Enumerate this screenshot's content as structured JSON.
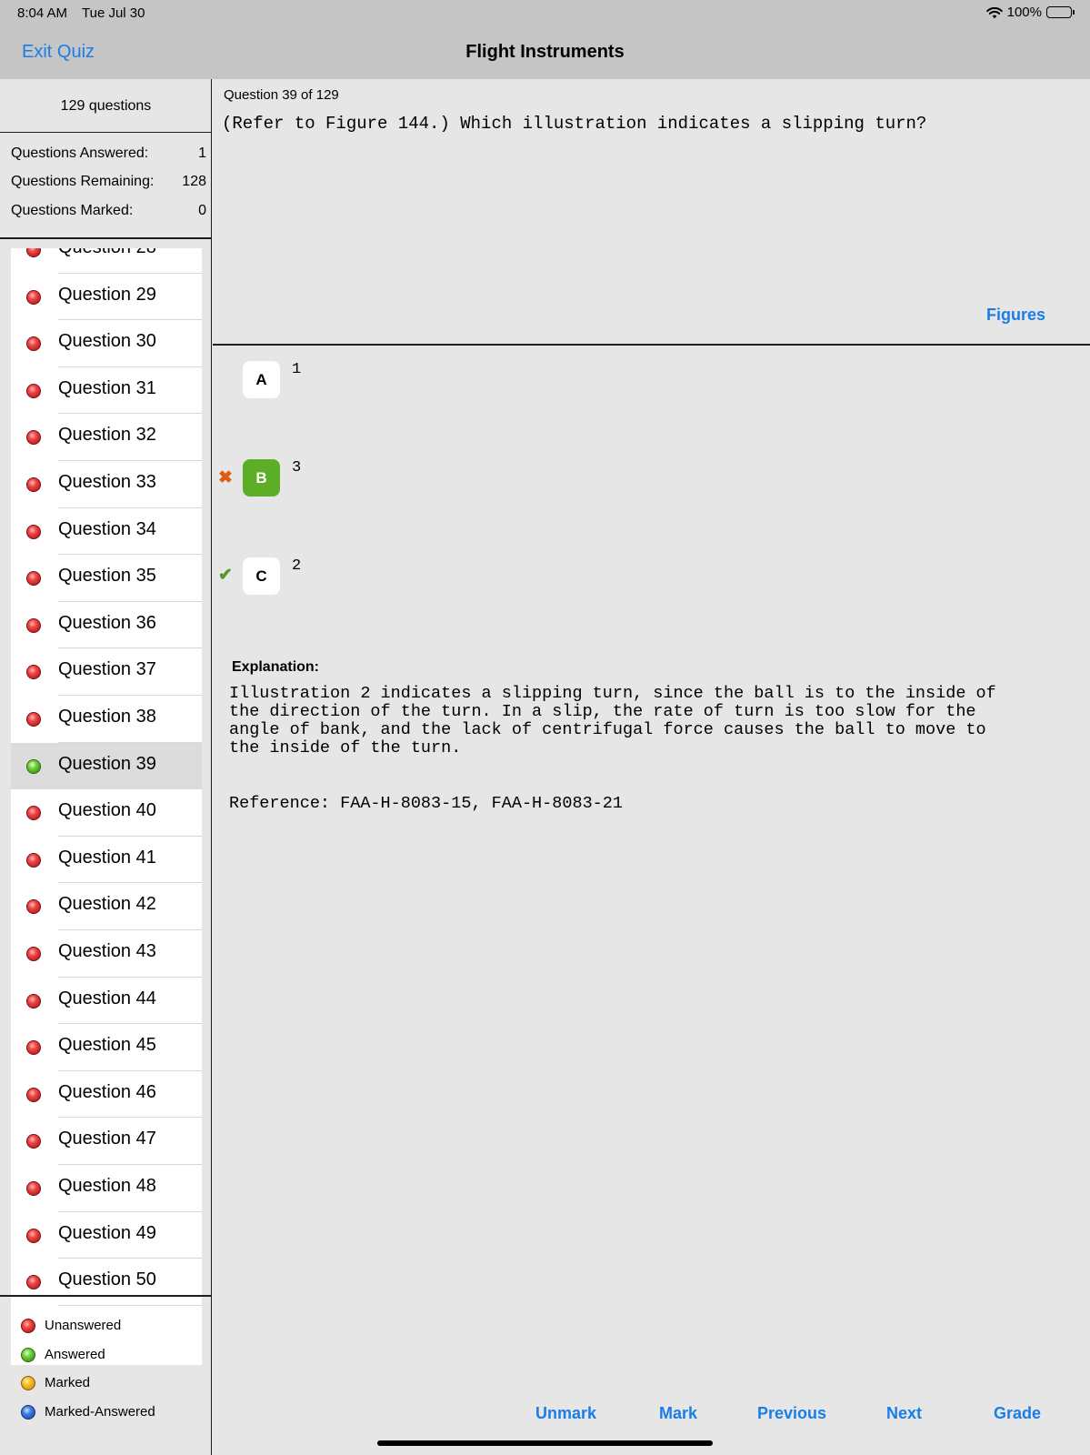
{
  "status_bar": {
    "time": "8:04 AM",
    "date": "Tue Jul 30",
    "battery": "100%"
  },
  "nav": {
    "exit_label": "Exit Quiz",
    "title": "Flight Instruments"
  },
  "sidebar": {
    "count_label": "129 questions",
    "stats": [
      {
        "label": "Questions Answered:",
        "value": "1"
      },
      {
        "label": "Questions Remaining:",
        "value": "128"
      },
      {
        "label": "Questions Marked:",
        "value": "0"
      }
    ],
    "questions": [
      {
        "label": "Question 28",
        "status": "unanswered"
      },
      {
        "label": "Question 29",
        "status": "unanswered"
      },
      {
        "label": "Question 30",
        "status": "unanswered"
      },
      {
        "label": "Question 31",
        "status": "unanswered"
      },
      {
        "label": "Question 32",
        "status": "unanswered"
      },
      {
        "label": "Question 33",
        "status": "unanswered"
      },
      {
        "label": "Question 34",
        "status": "unanswered"
      },
      {
        "label": "Question 35",
        "status": "unanswered"
      },
      {
        "label": "Question 36",
        "status": "unanswered"
      },
      {
        "label": "Question 37",
        "status": "unanswered"
      },
      {
        "label": "Question 38",
        "status": "unanswered"
      },
      {
        "label": "Question 39",
        "status": "answered",
        "selected": true
      },
      {
        "label": "Question 40",
        "status": "unanswered"
      },
      {
        "label": "Question 41",
        "status": "unanswered"
      },
      {
        "label": "Question 42",
        "status": "unanswered"
      },
      {
        "label": "Question 43",
        "status": "unanswered"
      },
      {
        "label": "Question 44",
        "status": "unanswered"
      },
      {
        "label": "Question 45",
        "status": "unanswered"
      },
      {
        "label": "Question 46",
        "status": "unanswered"
      },
      {
        "label": "Question 47",
        "status": "unanswered"
      },
      {
        "label": "Question 48",
        "status": "unanswered"
      },
      {
        "label": "Question 49",
        "status": "unanswered"
      },
      {
        "label": "Question 50",
        "status": "unanswered"
      }
    ],
    "legend": [
      {
        "label": "Unanswered",
        "color": "red"
      },
      {
        "label": "Answered",
        "color": "green"
      },
      {
        "label": "Marked",
        "color": "yellow"
      },
      {
        "label": "Marked-Answered",
        "color": "blue"
      }
    ]
  },
  "question": {
    "number_label": "Question 39 of 129",
    "text": "(Refer to Figure 144.) Which illustration indicates a slipping turn?",
    "figures_label": "Figures",
    "answers": [
      {
        "letter": "A",
        "text": "1",
        "chosen": false,
        "mark": ""
      },
      {
        "letter": "B",
        "text": "3",
        "chosen": true,
        "mark": "wrong"
      },
      {
        "letter": "C",
        "text": "2",
        "chosen": false,
        "mark": "correct"
      }
    ],
    "explanation_label": "Explanation:",
    "explanation_lines": [
      "Illustration 2 indicates a slipping turn, since the ball is to the inside of",
      "the direction of the turn. In a slip, the rate of turn is too slow for the",
      "angle of bank, and the lack of centrifugal force causes the ball to move to",
      "the inside of the turn."
    ],
    "reference": "Reference: FAA-H-8083-15, FAA-H-8083-21"
  },
  "toolbar": {
    "unmark": "Unmark",
    "mark": "Mark",
    "previous": "Previous",
    "next": "Next",
    "grade": "Grade"
  },
  "colors": {
    "accent": "#1a7de8",
    "chosen_answer": "#5cae26",
    "wrong_mark": "#e05a14",
    "correct_mark": "#4f9a28"
  }
}
